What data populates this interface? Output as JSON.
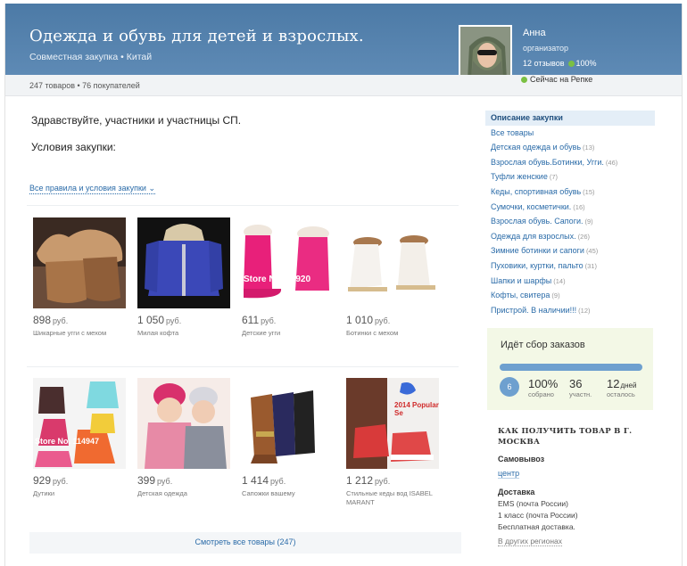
{
  "header": {
    "title": "Одежда и обувь для детей и взрослых.",
    "subtitle": "Совместная закупка • Китай",
    "stats": "247 товаров • 76 покупателей"
  },
  "organizer": {
    "name": "Анна",
    "role": "организатор",
    "reviews": "12 отзывов",
    "rating": "100%",
    "status": "Сейчас на Репке"
  },
  "main": {
    "greeting": "Здравствуйте, участники и участницы СП.",
    "conditions": "Условия закупки:",
    "rules_link": "Все правила и условия закупки",
    "all_goods_link": "Смотреть все товары (247)"
  },
  "products": [
    {
      "price": "898",
      "currency": "руб.",
      "name": "Шикарные угги с мехом",
      "icon": "fur-boots-image"
    },
    {
      "price": "1 050",
      "currency": "руб.",
      "name": "Милая кофта",
      "icon": "blue-jacket-image"
    },
    {
      "price": "611",
      "currency": "руб.",
      "name": "Детские угги",
      "icon": "pink-boots-image",
      "watermark": "Store No. 17920"
    },
    {
      "price": "1 010",
      "currency": "руб.",
      "name": "Ботинки с мехом",
      "icon": "white-boots-image"
    },
    {
      "price": "929",
      "currency": "руб.",
      "name": "Дутики",
      "icon": "kids-boots-image",
      "watermark": "Store No. 114947"
    },
    {
      "price": "399",
      "currency": "руб.",
      "name": "Детская одежда",
      "icon": "kids-photo-image"
    },
    {
      "price": "1 414",
      "currency": "руб.",
      "name": "Сапожки вашему",
      "icon": "suede-boots-image"
    },
    {
      "price": "1 212",
      "currency": "руб.",
      "name": "Стильные кеды вод ISABEL MARANT",
      "icon": "sneakers-image",
      "watermark": "2014 Popular Se"
    }
  ],
  "sidebar": {
    "items": [
      {
        "label": "Описание закупки",
        "count": "",
        "active": true
      },
      {
        "label": "Все товары",
        "count": ""
      },
      {
        "label": "Детская одежда и обувь",
        "count": "(13)"
      },
      {
        "label": "Взрослая обувь.Ботинки, Угги.",
        "count": "(46)"
      },
      {
        "label": "Туфли женские",
        "count": "(7)"
      },
      {
        "label": "Кеды, спортивная обувь",
        "count": "(15)"
      },
      {
        "label": "Сумочки, косметички.",
        "count": "(16)"
      },
      {
        "label": "Взрослая обувь. Сапоги.",
        "count": "(9)"
      },
      {
        "label": "Одежда для взрослых.",
        "count": "(26)"
      },
      {
        "label": "Зимние ботинки и сапоги",
        "count": "(45)"
      },
      {
        "label": "Пуховики, куртки, пальто",
        "count": "(31)"
      },
      {
        "label": "Шапки и шарфы",
        "count": "(14)"
      },
      {
        "label": "Кофты, свитера",
        "count": "(9)"
      },
      {
        "label": "Пристрой. В наличии!!!",
        "count": "(12)"
      }
    ]
  },
  "collect": {
    "title": "Идёт сбор заказов",
    "progress": 1.0,
    "round_number": "6",
    "percent": "100%",
    "percent_label": "собрано",
    "participants": "36",
    "participants_label": "участн.",
    "days": "12",
    "days_unit": "дней",
    "days_label": "осталось"
  },
  "delivery": {
    "title": "КАК ПОЛУЧИТЬ ТОВАР В Г. МОСКВА",
    "pickup_heading": "Самовывоз",
    "pickup_link": "центр",
    "delivery_heading": "Доставка",
    "line1": "EMS (почта России)",
    "line2": "1 класс (почта России)",
    "line3": "Бесплатная доставка.",
    "other_regions": "В других регионах"
  },
  "colors": {
    "header": "#5682ae",
    "link": "#2a6ba8",
    "progress": "#6ea0cf",
    "collect_bg": "#f3f8e6"
  }
}
